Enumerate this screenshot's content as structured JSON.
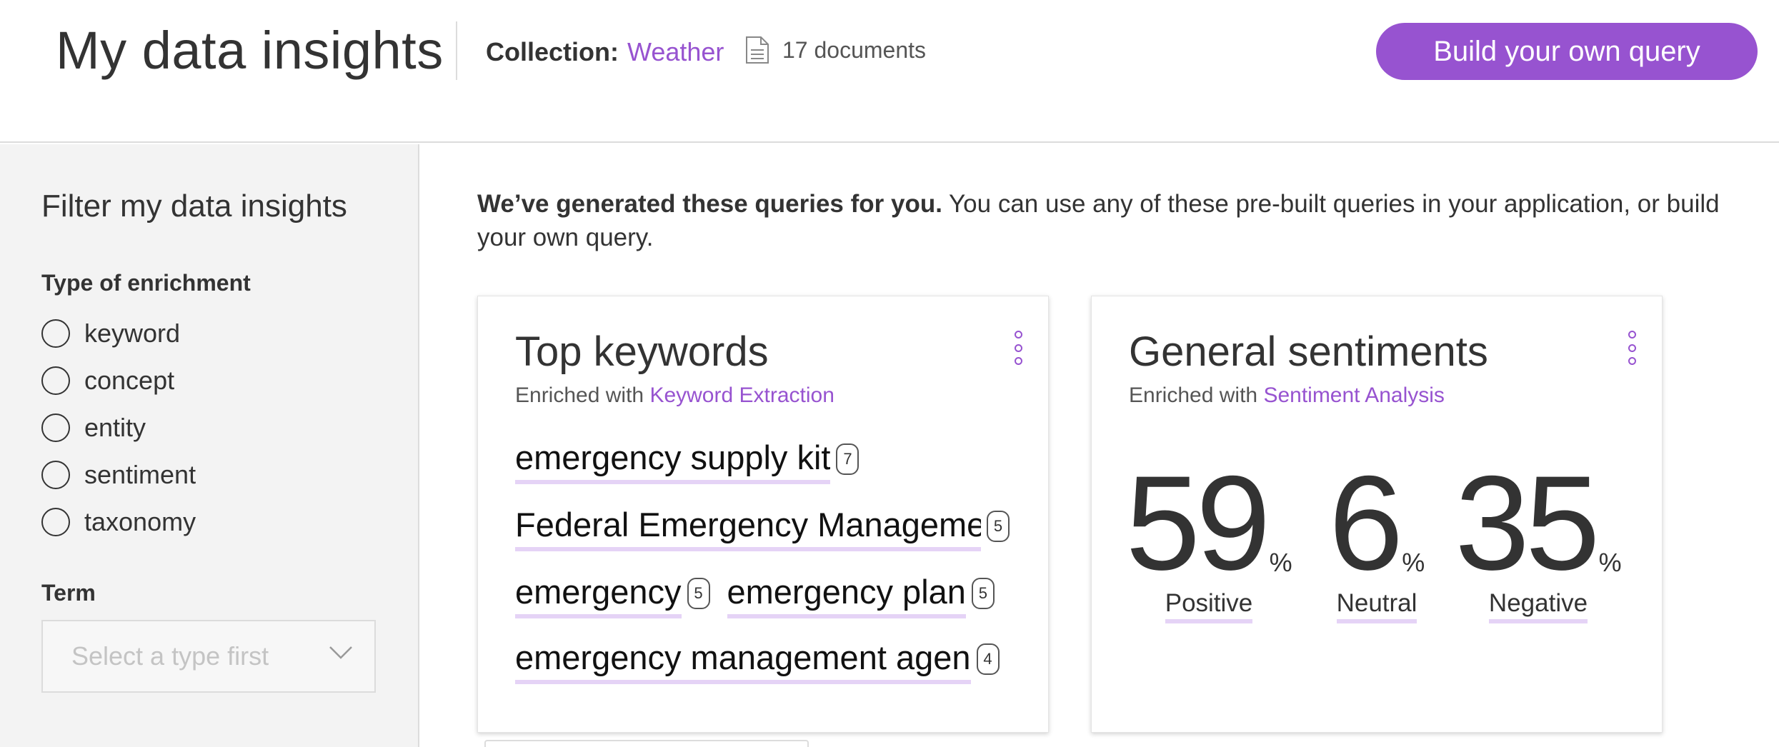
{
  "header": {
    "title": "My data insights",
    "collection_label": "Collection:",
    "collection_name": "Weather",
    "document_count": "17 documents",
    "build_button": "Build your own query"
  },
  "sidebar": {
    "title": "Filter my data insights",
    "enrichment_label": "Type of enrichment",
    "enrichment_options": [
      "keyword",
      "concept",
      "entity",
      "sentiment",
      "taxonomy"
    ],
    "term_label": "Term",
    "term_placeholder": "Select a type first"
  },
  "main": {
    "intro_bold": "We’ve generated these queries for you.",
    "intro_rest": " You can use any of these pre-built queries in your application, or build your own query."
  },
  "keywords_card": {
    "title": "Top keywords",
    "enriched_prefix": "Enriched with ",
    "enriched_link": "Keyword Extraction",
    "keywords": [
      {
        "text": "emergency supply kit",
        "count": "7"
      },
      {
        "text": "Federal Emergency Manageme",
        "count": "5"
      },
      {
        "text": "emergency",
        "count": "5"
      },
      {
        "text": "emergency plan",
        "count": "5"
      },
      {
        "text": "emergency management agen",
        "count": "4"
      }
    ]
  },
  "sentiment_card": {
    "title": "General sentiments",
    "enriched_prefix": "Enriched with ",
    "enriched_link": "Sentiment Analysis",
    "stats": [
      {
        "value": "59",
        "unit": "%",
        "label": "Positive"
      },
      {
        "value": "6",
        "unit": "%",
        "label": "Neutral"
      },
      {
        "value": "35",
        "unit": "%",
        "label": "Negative"
      }
    ]
  },
  "colors": {
    "accent": "#9753d0",
    "underline": "#e5d3f6",
    "sidebar_bg": "#f3f3f3"
  },
  "icons": {
    "document": "document-icon",
    "chevron": "chevron-down-icon",
    "menu": "overflow-menu-icon"
  }
}
